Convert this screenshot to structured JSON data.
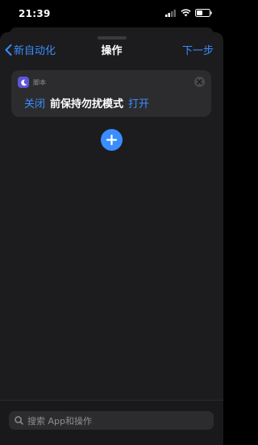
{
  "status_bar": {
    "time": "21:39"
  },
  "nav": {
    "back_label": "新自动化",
    "title": "操作",
    "next_label": "下一步"
  },
  "action_card": {
    "category": "脚本",
    "verb": "关闭",
    "text": "前保持勿扰模式",
    "param": "打开",
    "icon": "moon-icon",
    "accent": "#5e55d8"
  },
  "add_button": {
    "icon": "plus-icon",
    "color": "#3a8dff"
  },
  "search": {
    "placeholder": "搜索 App和操作"
  },
  "colors": {
    "link": "#3a8dff",
    "sheet": "#1c1c1e",
    "card": "#2c2c2e"
  }
}
